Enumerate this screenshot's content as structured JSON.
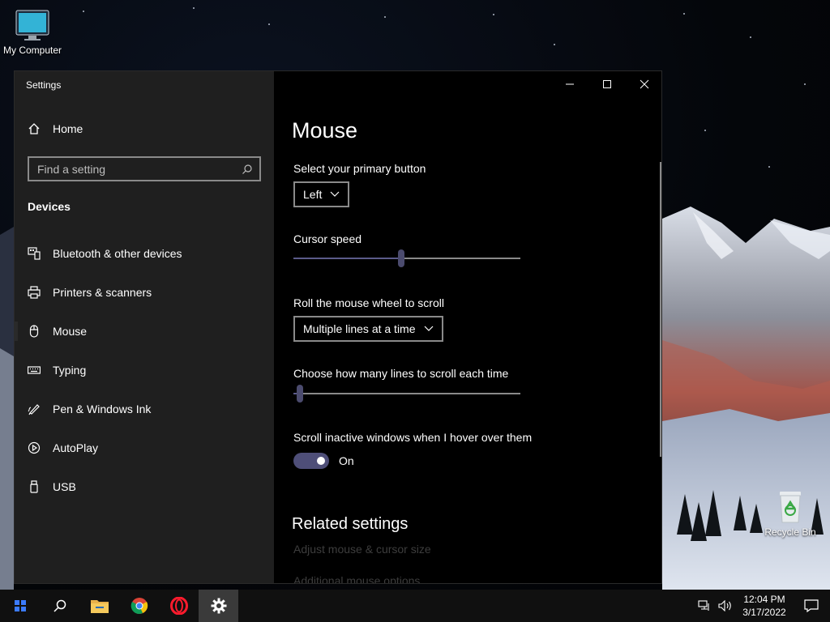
{
  "desktop": {
    "icons": {
      "my_computer": "My Computer",
      "recycle_bin": "Recycle Bin"
    }
  },
  "window": {
    "title": "Settings",
    "controls": [
      "minimize-icon",
      "maximize-icon",
      "close-icon"
    ]
  },
  "sidebar": {
    "home_label": "Home",
    "search_placeholder": "Find a setting",
    "section_label": "Devices",
    "items": [
      {
        "label": "Bluetooth & other devices",
        "icon": "bluetooth-devices-icon"
      },
      {
        "label": "Printers & scanners",
        "icon": "printer-icon"
      },
      {
        "label": "Mouse",
        "icon": "mouse-icon"
      },
      {
        "label": "Typing",
        "icon": "keyboard-icon"
      },
      {
        "label": "Pen & Windows Ink",
        "icon": "pen-icon"
      },
      {
        "label": "AutoPlay",
        "icon": "autoplay-icon"
      },
      {
        "label": "USB",
        "icon": "usb-icon"
      }
    ],
    "active_index": 2
  },
  "content": {
    "title": "Mouse",
    "primary_button": {
      "label": "Select your primary button",
      "value": "Left"
    },
    "cursor_speed": {
      "label": "Cursor speed",
      "value": 0.475
    },
    "wheel_scroll": {
      "label": "Roll the mouse wheel to scroll",
      "value": "Multiple lines at a time"
    },
    "lines_to_scroll": {
      "label": "Choose how many lines to scroll each time",
      "value": 0.03
    },
    "inactive_scroll": {
      "label": "Scroll inactive windows when I hover over them",
      "state": "On",
      "on": true
    },
    "related_title": "Related settings",
    "links": [
      "Adjust mouse & cursor size",
      "Additional mouse options"
    ]
  },
  "taskbar": {
    "apps": [
      "start-icon",
      "search-icon",
      "file-explorer-icon",
      "chrome-icon",
      "opera-icon",
      "settings-icon"
    ],
    "active_app": "settings-icon",
    "time": "12:04 PM",
    "date": "3/17/2022"
  },
  "colors": {
    "accent": "#4e4e78",
    "sidebar_bg": "#1f1f1f",
    "content_bg": "#000000",
    "taskbar_bg": "#101010"
  }
}
